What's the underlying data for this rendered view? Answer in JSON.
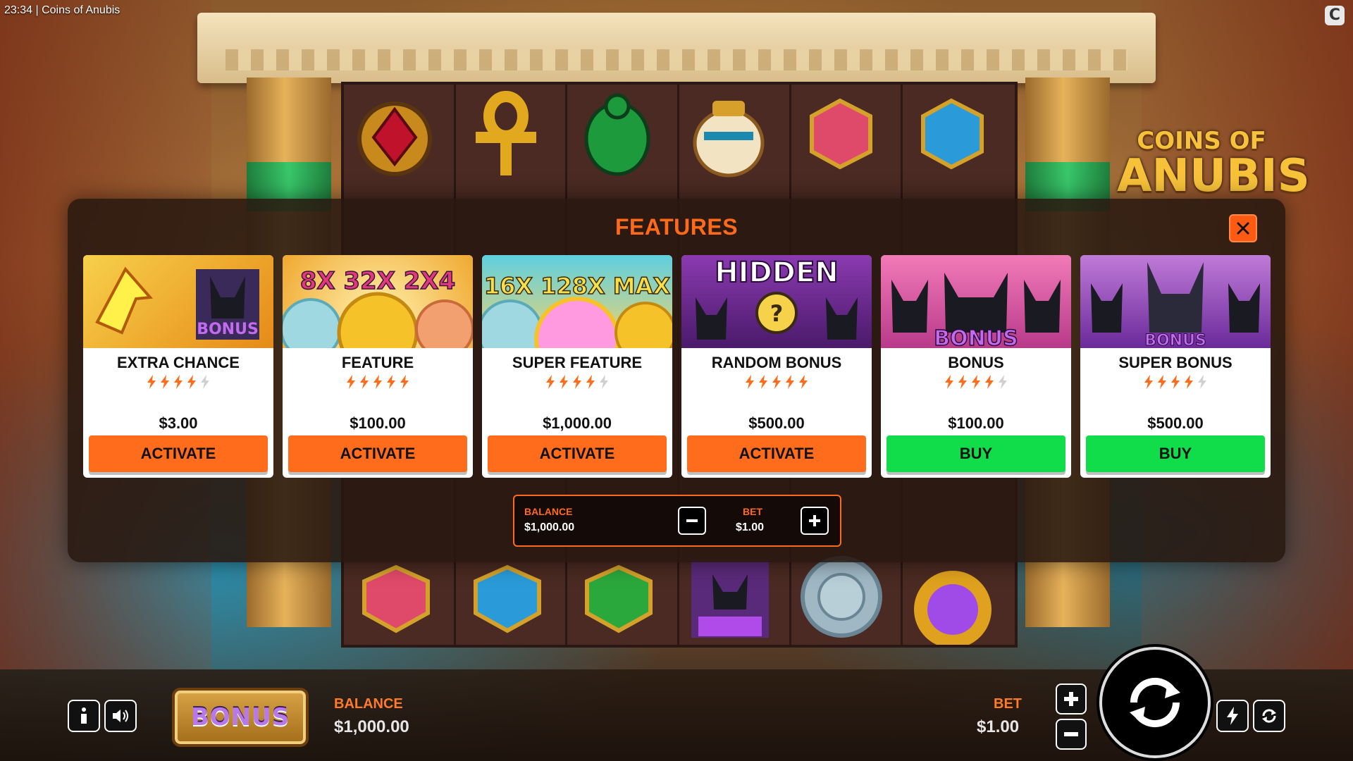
{
  "status_bar": {
    "time_title": "23:34 | Coins of Anubis"
  },
  "game_logo": {
    "line1": "COINS OF",
    "line2": "ANUBIS"
  },
  "modal": {
    "title": "FEATURES",
    "cards": [
      {
        "title": "EXTRA CHANCE",
        "rating": 4,
        "price": "$3.00",
        "button": "ACTIVATE",
        "button_color": "#ff6d1c",
        "image_text": "BONUS",
        "image_bg": "#f3b232"
      },
      {
        "title": "FEATURE",
        "rating": 5,
        "price": "$100.00",
        "button": "ACTIVATE",
        "button_color": "#ff6d1c",
        "image_text": "8X 32X 2X4",
        "image_bg": "#f7c24a"
      },
      {
        "title": "SUPER FEATURE",
        "rating": 4,
        "price": "$1,000.00",
        "button": "ACTIVATE",
        "button_color": "#ff6d1c",
        "image_text": "16X 128X MAX",
        "image_bg": "#58c8d8"
      },
      {
        "title": "RANDOM BONUS",
        "rating": 5,
        "price": "$500.00",
        "button": "ACTIVATE",
        "button_color": "#ff6d1c",
        "image_text": "HIDDEN",
        "image_bg": "#7a2a9a"
      },
      {
        "title": "BONUS",
        "rating": 4,
        "price": "$100.00",
        "button": "BUY",
        "button_color": "#11dd4a",
        "image_text": "BONUS",
        "image_bg": "#d8559a"
      },
      {
        "title": "SUPER BONUS",
        "rating": 4,
        "price": "$500.00",
        "button": "BUY",
        "button_color": "#11dd4a",
        "image_text": "BONUS",
        "image_bg": "#a05ac8"
      }
    ],
    "wallet": {
      "balance_label": "BALANCE",
      "balance_value": "$1,000.00",
      "bet_label": "BET",
      "bet_value": "$1.00"
    }
  },
  "bottom_bar": {
    "bonus_button": "BONUS",
    "balance_label": "BALANCE",
    "balance_value": "$1,000.00",
    "bet_label": "BET",
    "bet_value": "$1.00"
  },
  "colors": {
    "accent": "#ff6a1a",
    "buy_green": "#11dd4a",
    "activate_orange": "#ff6d1c"
  },
  "icons": [
    "info-icon",
    "sound-icon",
    "plus-icon",
    "minus-icon",
    "spin-icon",
    "turbo-icon",
    "autoplay-icon",
    "close-icon",
    "lightning-icon"
  ]
}
